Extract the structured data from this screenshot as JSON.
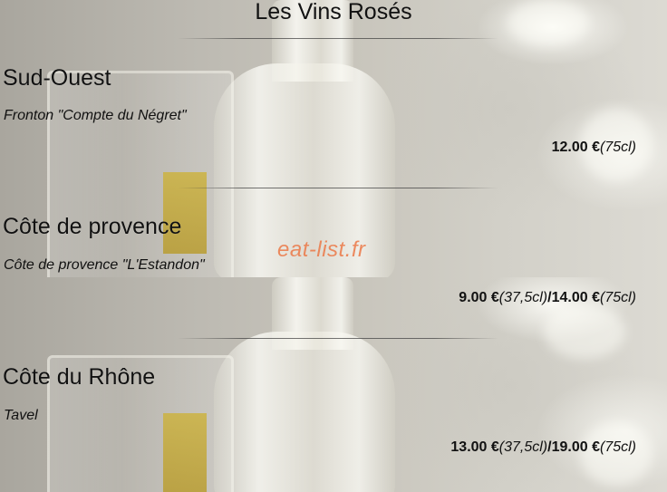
{
  "page": {
    "title": "Les Vins Rosés",
    "watermark": "eat-list.fr"
  },
  "sections": [
    {
      "region": "Sud-Ouest",
      "wine": "Fronton \"Compte du Négret\"",
      "prices": [
        {
          "amount": "12.00 €",
          "volume": "(75cl)"
        }
      ]
    },
    {
      "region": "Côte de provence",
      "wine": "Côte de provence \"L'Estandon\"",
      "prices": [
        {
          "amount": "9.00 €",
          "volume": "(37,5cl)"
        },
        {
          "amount": "14.00 €",
          "volume": "(75cl)"
        }
      ]
    },
    {
      "region": "Côte du Rhône",
      "wine": "Tavel",
      "prices": [
        {
          "amount": "13.00 €",
          "volume": "(37,5cl)"
        },
        {
          "amount": "19.00 €",
          "volume": "(75cl)"
        }
      ]
    }
  ],
  "separator": "/"
}
